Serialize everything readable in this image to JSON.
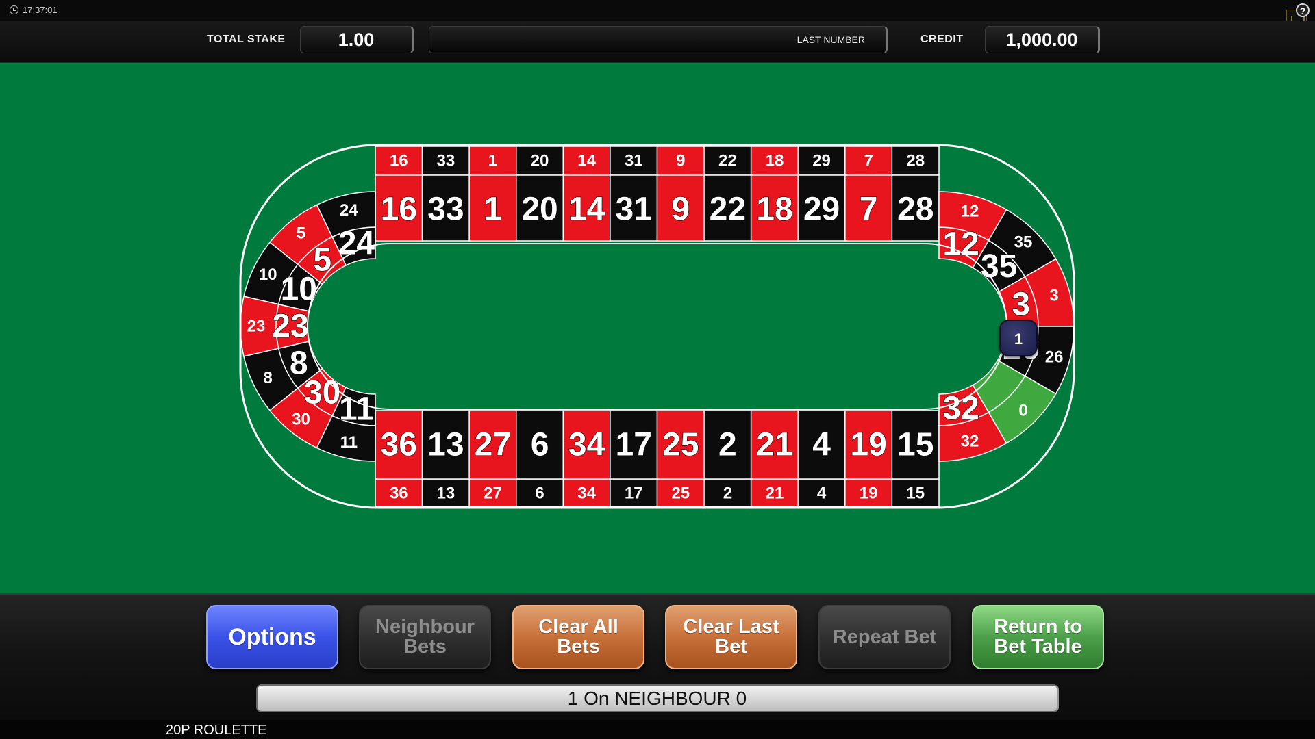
{
  "status_bar": {
    "time": "17:37:01",
    "help_icon": "?"
  },
  "header": {
    "total_stake_label": "TOTAL STAKE",
    "total_stake_value": "1.00",
    "last_number_label": "LAST NUMBER",
    "credit_label": "CREDIT",
    "credit_value": "1,000.00"
  },
  "colors": {
    "felt": "#007a3d",
    "red": "#e8151f",
    "black": "#0c0c0c",
    "green_zero": "#3fa940"
  },
  "racetrack": {
    "top_row": [
      {
        "n": "16",
        "c": "red"
      },
      {
        "n": "33",
        "c": "black"
      },
      {
        "n": "1",
        "c": "red"
      },
      {
        "n": "20",
        "c": "black"
      },
      {
        "n": "14",
        "c": "red"
      },
      {
        "n": "31",
        "c": "black"
      },
      {
        "n": "9",
        "c": "red"
      },
      {
        "n": "22",
        "c": "black"
      },
      {
        "n": "18",
        "c": "red"
      },
      {
        "n": "29",
        "c": "black"
      },
      {
        "n": "7",
        "c": "red"
      },
      {
        "n": "28",
        "c": "black"
      }
    ],
    "bottom_row": [
      {
        "n": "36",
        "c": "red"
      },
      {
        "n": "13",
        "c": "black"
      },
      {
        "n": "27",
        "c": "red"
      },
      {
        "n": "6",
        "c": "black"
      },
      {
        "n": "34",
        "c": "red"
      },
      {
        "n": "17",
        "c": "black"
      },
      {
        "n": "25",
        "c": "red"
      },
      {
        "n": "2",
        "c": "black"
      },
      {
        "n": "21",
        "c": "red"
      },
      {
        "n": "4",
        "c": "black"
      },
      {
        "n": "19",
        "c": "red"
      },
      {
        "n": "15",
        "c": "black"
      }
    ],
    "left_arc": [
      {
        "n": "24",
        "c": "black"
      },
      {
        "n": "5",
        "c": "red"
      },
      {
        "n": "10",
        "c": "black"
      },
      {
        "n": "23",
        "c": "red"
      },
      {
        "n": "8",
        "c": "black"
      },
      {
        "n": "30",
        "c": "red"
      },
      {
        "n": "11",
        "c": "black"
      }
    ],
    "right_arc": [
      {
        "n": "12",
        "c": "red"
      },
      {
        "n": "35",
        "c": "black"
      },
      {
        "n": "3",
        "c": "red"
      },
      {
        "n": "26",
        "c": "black"
      },
      {
        "n": "0",
        "c": "green"
      },
      {
        "n": "32",
        "c": "red"
      }
    ],
    "chip": {
      "number": "0",
      "value": "1"
    }
  },
  "buttons": {
    "options": "Options",
    "neighbour_bets": [
      "Neighbour",
      "Bets"
    ],
    "clear_all_bets": [
      "Clear All",
      "Bets"
    ],
    "clear_last_bet": [
      "Clear Last",
      "Bet"
    ],
    "repeat_bet": "Repeat Bet",
    "return_to_bet_table": [
      "Return to",
      "Bet Table"
    ]
  },
  "message": "1 On NEIGHBOUR 0",
  "game_title": "20P ROULETTE"
}
